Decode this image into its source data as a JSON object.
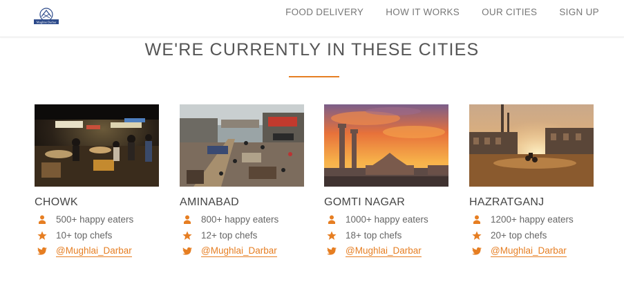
{
  "header": {
    "logo_text": "Mughlai Darbar",
    "nav": [
      {
        "label": "FOOD DELIVERY"
      },
      {
        "label": "HOW IT WORKS"
      },
      {
        "label": "OUR CITIES"
      },
      {
        "label": "SIGN UP"
      }
    ]
  },
  "section": {
    "title": "WE'RE CURRENTLY IN THESE CITIES",
    "accent_color": "#e67e22"
  },
  "cities": [
    {
      "name": "CHOWK",
      "eaters": "500+ happy eaters",
      "chefs": "10+ top chefs",
      "twitter": "@Mughlai_Darbar",
      "photo": "night-market-photo"
    },
    {
      "name": "AMINABAD",
      "eaters": "800+ happy eaters",
      "chefs": "12+ top chefs",
      "twitter": "@Mughlai_Darbar",
      "photo": "busy-street-photo"
    },
    {
      "name": "GOMTI NAGAR",
      "eaters": "1000+ happy eaters",
      "chefs": "18+ top chefs",
      "twitter": "@Mughlai_Darbar",
      "photo": "sunset-monument-photo"
    },
    {
      "name": "HAZRATGANJ",
      "eaters": "1200+ happy eaters",
      "chefs": "20+ top chefs",
      "twitter": "@Mughlai_Darbar",
      "photo": "evening-square-photo"
    }
  ],
  "icons": {
    "eaters": "user-icon",
    "chefs": "star-icon",
    "twitter": "twitter-icon"
  }
}
